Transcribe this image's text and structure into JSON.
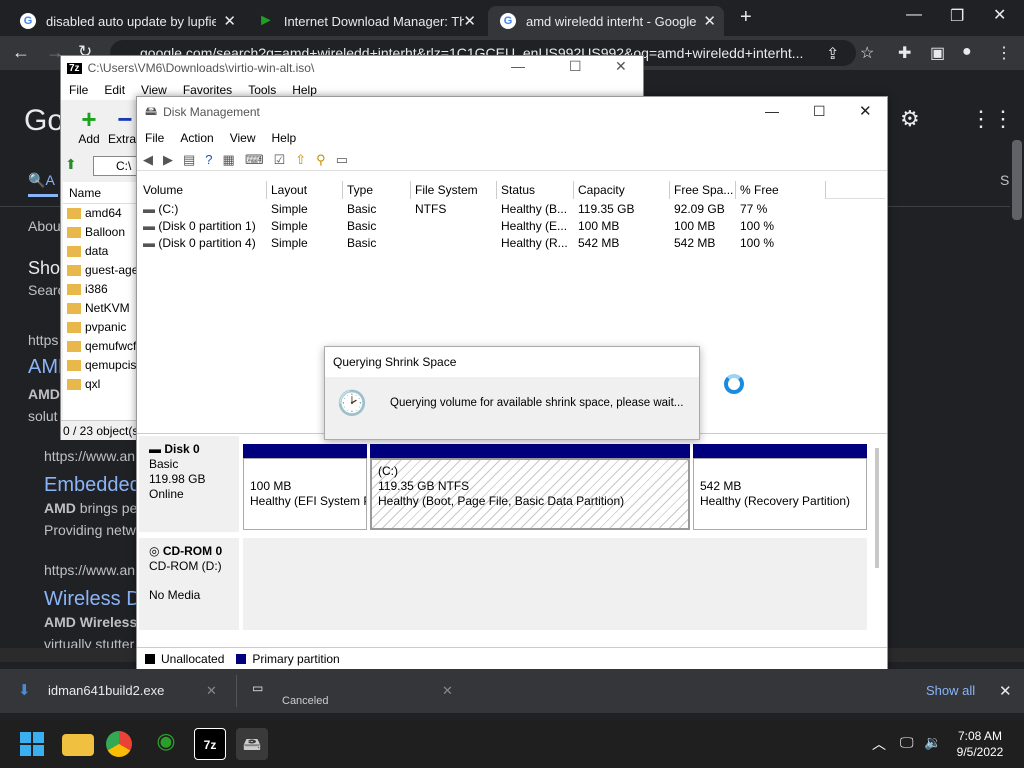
{
  "chrome": {
    "tabs": [
      {
        "title": "disabled auto update by lupfiei -",
        "close": "✕"
      },
      {
        "title": "Internet Download Manager: The",
        "close": "✕"
      },
      {
        "title": "amd wireledd interht - Google Se",
        "close": "✕"
      }
    ],
    "new_tab": "+",
    "url": "google.com/search?q=amd+wireledd+interht&rlz=1C1GCEU_enUS992US992&oq=amd+wireledd+interht...",
    "google_logo": "Go"
  },
  "google_page": {
    "tab_a": "A",
    "tab_s": "S",
    "about": "Abou",
    "shop_title": "Sho",
    "shop_sub": "Searc",
    "link1": "https",
    "result1_title": "AMD",
    "result1_line1": "AMD",
    "result1_line2": "solut",
    "result2_url": "https://www.an",
    "result2_title": "Embedded",
    "result2_line1_bold": "AMD",
    "result2_line1": " brings pe",
    "result2_line2": "Providing netw",
    "result3_url": "https://www.an",
    "result3_title": "Wireless D",
    "result3_line1": "AMD Wireless",
    "result3_line2": "virtually stutter"
  },
  "sevenzip": {
    "icon": "7z",
    "title": "C:\\Users\\VM6\\Downloads\\virtio-win-alt.iso\\",
    "menu": [
      "File",
      "Edit",
      "View",
      "Favorites",
      "Tools",
      "Help"
    ],
    "add_label": "Add",
    "extract_label": "Extrac",
    "path": "C:\\",
    "name_header": "Name",
    "files": [
      "amd64",
      "Balloon",
      "data",
      "guest-age",
      "i386",
      "NetKVM",
      "pvpanic",
      "qemufwcf",
      "qemupciser",
      "qxl"
    ],
    "status": "0 / 23 object(s"
  },
  "disk_mgmt": {
    "title": "Disk Management",
    "menu": [
      "File",
      "Action",
      "View",
      "Help"
    ],
    "columns": [
      "Volume",
      "Layout",
      "Type",
      "File System",
      "Status",
      "Capacity",
      "Free Spa...",
      "% Free"
    ],
    "volumes": [
      [
        "(C:)",
        "Simple",
        "Basic",
        "NTFS",
        "Healthy (B...",
        "119.35 GB",
        "92.09 GB",
        "77 %"
      ],
      [
        "(Disk 0 partition 1)",
        "Simple",
        "Basic",
        "",
        "Healthy (E...",
        "100 MB",
        "100 MB",
        "100 %"
      ],
      [
        "(Disk 0 partition 4)",
        "Simple",
        "Basic",
        "",
        "Healthy (R...",
        "542 MB",
        "542 MB",
        "100 %"
      ]
    ],
    "disk0": {
      "name": "Disk 0",
      "type": "Basic",
      "size": "119.98 GB",
      "state": "Online"
    },
    "partitions": [
      {
        "size": "100 MB",
        "desc": "Healthy (EFI System P"
      },
      {
        "label": "(C:)",
        "size": "119.35 GB NTFS",
        "desc": "Healthy (Boot, Page File, Basic Data Partition)"
      },
      {
        "size": "542 MB",
        "desc": "Healthy (Recovery Partition)"
      }
    ],
    "cdrom": {
      "name": "CD-ROM 0",
      "drive": "CD-ROM (D:)",
      "media": "No Media"
    },
    "legend": {
      "unallocated": "Unallocated",
      "primary": "Primary partition"
    }
  },
  "dialog": {
    "title": "Querying Shrink Space",
    "message": "Querying volume for available shrink space, please wait..."
  },
  "downloads": {
    "file": "idman641build2.exe",
    "canceled": "Canceled",
    "show_all": "Show all",
    "close": "✕"
  },
  "taskbar": {
    "time": "7:08 AM",
    "date": "9/5/2022",
    "app_7z": "7z"
  },
  "colors": {
    "primary_partition": "#00007f",
    "accent": "#8ab4f8"
  }
}
